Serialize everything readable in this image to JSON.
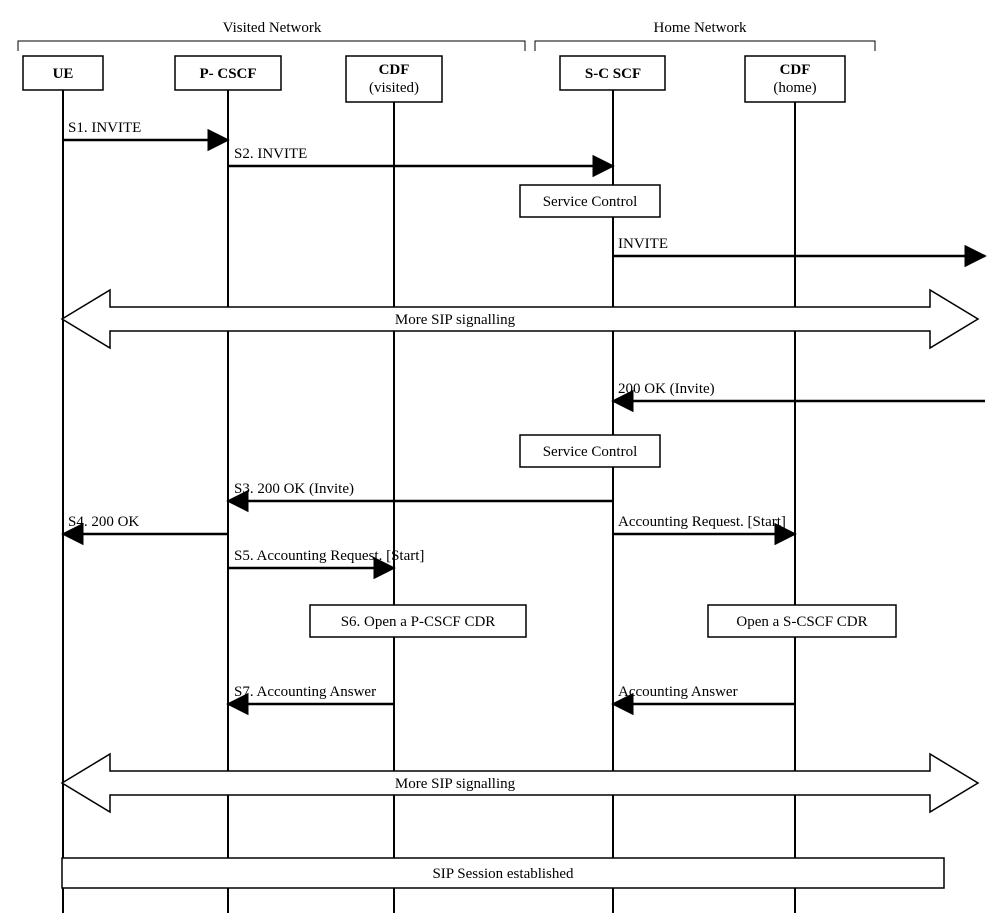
{
  "header": {
    "visited": "Visited Network",
    "home": "Home Network"
  },
  "lifelines": {
    "ue": {
      "label": "UE",
      "sub": ""
    },
    "pcscf": {
      "label": "P- CSCF",
      "sub": ""
    },
    "cdf_v": {
      "label": "CDF",
      "sub": "(visited)"
    },
    "scscf": {
      "label": "S-C SCF",
      "sub": ""
    },
    "cdf_h": {
      "label": "CDF",
      "sub": "(home)"
    }
  },
  "messages": {
    "s1": "S1. INVITE",
    "s2": "S2. INVITE",
    "svc_ctrl_1": "Service Control",
    "invite_out": "INVITE",
    "more_sip_1": "More  SIP signalling",
    "ok_in": "200 OK (Invite)",
    "svc_ctrl_2": "Service Control",
    "s3": "S3. 200 OK (Invite)",
    "s4": "S4. 200 OK",
    "acct_req_h": "Accounting Request. [Start]",
    "s5": "S5. Accounting Request. [Start]",
    "s6": "S6. Open a P-CSCF CDR",
    "open_s": "Open a  S-CSCF CDR",
    "s7": "S7. Accounting Answer",
    "acct_ans_h": "Accounting Answer",
    "more_sip_2": "More  SIP signalling",
    "established": "SIP Session established"
  }
}
